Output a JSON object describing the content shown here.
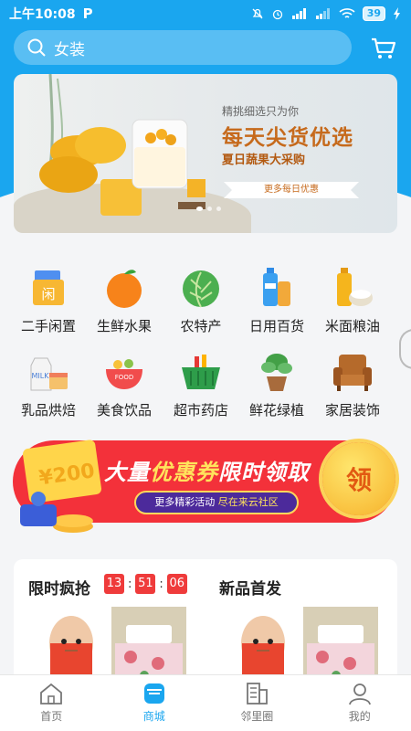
{
  "status": {
    "time": "上午10:08",
    "p_label": "P",
    "battery": "39"
  },
  "search": {
    "placeholder": "女装"
  },
  "banner": {
    "subtitle": "精挑细选只为你",
    "title": "每天尖货优选",
    "tagline": "夏日蔬果大采购",
    "button": "更多每日优惠"
  },
  "categories": [
    {
      "label": "二手闲置",
      "icon": "secondhand-bag-icon",
      "icon_text": "闲"
    },
    {
      "label": "生鲜水果",
      "icon": "orange-icon"
    },
    {
      "label": "农特产",
      "icon": "cabbage-icon"
    },
    {
      "label": "日用百货",
      "icon": "toiletries-icon"
    },
    {
      "label": "米面粮油",
      "icon": "rice-oil-icon"
    },
    {
      "label": "乳品烘焙",
      "icon": "milk-cake-icon",
      "icon_text": "MILK"
    },
    {
      "label": "美食饮品",
      "icon": "food-bowl-icon",
      "icon_text": "FOOD"
    },
    {
      "label": "超市药店",
      "icon": "shopping-basket-icon"
    },
    {
      "label": "鲜花绿植",
      "icon": "potted-plant-icon"
    },
    {
      "label": "家居装饰",
      "icon": "armchair-icon"
    }
  ],
  "promo": {
    "title_a": "大量",
    "title_b": "优惠券",
    "title_c": "限时领取",
    "pill_a": "更多精彩活动",
    "pill_b": "尽在来云社区",
    "coin": "领",
    "ticket": "¥200"
  },
  "flash": {
    "title": "限时疯抢",
    "timer": [
      "13",
      "51",
      "06"
    ],
    "new_title": "新品首发"
  },
  "tabs": [
    {
      "label": "首页",
      "icon": "home-icon"
    },
    {
      "label": "商城",
      "icon": "store-icon",
      "active": true
    },
    {
      "label": "邻里圈",
      "icon": "neighborhood-icon"
    },
    {
      "label": "我的",
      "icon": "profile-icon"
    }
  ],
  "colors": {
    "brand": "#1aa6ef",
    "promo_red": "#f3313a",
    "timer_red": "#ef3b3b"
  }
}
